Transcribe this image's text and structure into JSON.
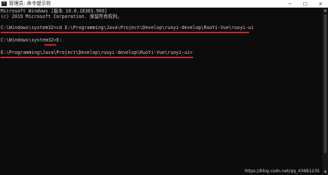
{
  "window": {
    "title": "管理员: 命令提示符",
    "icon": "cmd-icon",
    "controls": {
      "minimize": "─",
      "maximize": "☐",
      "close": "✕"
    }
  },
  "console": {
    "lines": [
      "Microsoft Windows [版本 10.0.18363.900]",
      "(c) 2019 Microsoft Corporation. 保留所有权利。",
      "",
      "C:\\Windows\\system32>cd E:\\Programming\\Java\\Project\\Develop\\ruoyi-develop\\RuoYi-Vue\\ruoyi-ui",
      "",
      "C:\\Windows\\system32>E:",
      "",
      "E:\\Programming\\Java\\Project\\Develop\\ruoyi-develop\\RuoYi-Vue\\ruoyi-ui>"
    ]
  },
  "annotations": {
    "highlight_color": "#e0201c"
  },
  "scrollbar": {
    "up": "▲",
    "down": "▼"
  },
  "watermark": "https://blog.csdn.net/qq_43681235"
}
